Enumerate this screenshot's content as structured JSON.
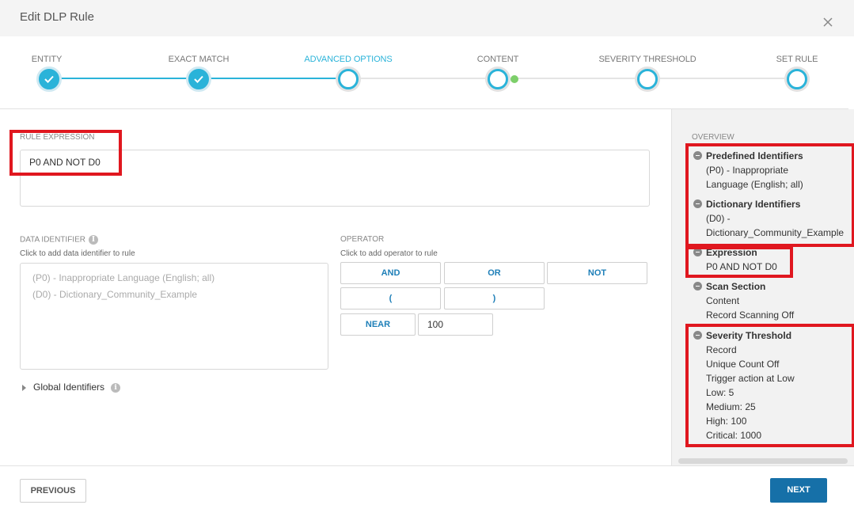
{
  "dialog": {
    "title": "Edit DLP Rule"
  },
  "steps": [
    {
      "label": "ENTITY",
      "state": "done"
    },
    {
      "label": "EXACT MATCH",
      "state": "done"
    },
    {
      "label": "ADVANCED OPTIONS",
      "state": "active"
    },
    {
      "label": "CONTENT",
      "state": "open"
    },
    {
      "label": "SEVERITY THRESHOLD",
      "state": "open"
    },
    {
      "label": "SET RULE",
      "state": "open"
    }
  ],
  "rule_expression": {
    "label": "RULE EXPRESSION",
    "value": "P0 AND NOT D0"
  },
  "data_identifier": {
    "label": "DATA IDENTIFIER",
    "hint": "Click to add data identifier to rule",
    "items": [
      "(P0) - Inappropriate Language (English; all)",
      "(D0) - Dictionary_Community_Example"
    ]
  },
  "operator": {
    "label": "OPERATOR",
    "hint": "Click to add operator to rule",
    "and_label": "AND",
    "or_label": "OR",
    "not_label": "NOT",
    "open_paren_label": "(",
    "close_paren_label": ")",
    "near_label": "NEAR",
    "near_value": "100"
  },
  "global_identifiers": {
    "label": "Global Identifiers"
  },
  "overview": {
    "label": "OVERVIEW",
    "predefined": {
      "title": "Predefined Identifiers",
      "lines": [
        "(P0) - Inappropriate",
        "Language (English; all)"
      ]
    },
    "dictionary": {
      "title": "Dictionary Identifiers",
      "lines": [
        "(D0) -",
        "Dictionary_Community_Example"
      ]
    },
    "expression": {
      "title": "Expression",
      "lines": [
        "P0 AND NOT D0"
      ]
    },
    "scan": {
      "title": "Scan Section",
      "lines": [
        "Content",
        "Record Scanning Off"
      ]
    },
    "severity": {
      "title": "Severity Threshold",
      "lines": [
        "Record",
        "Unique Count Off",
        "Trigger action at Low",
        "Low: 5",
        "Medium: 25",
        "High: 100",
        "Critical: 1000"
      ]
    }
  },
  "footer": {
    "previous_label": "PREVIOUS",
    "next_label": "NEXT"
  },
  "colors": {
    "accent": "#2ab3d9",
    "primary_button": "#1670a8",
    "highlight_box": "#e0171f",
    "content_dot": "#7dcf6a"
  }
}
